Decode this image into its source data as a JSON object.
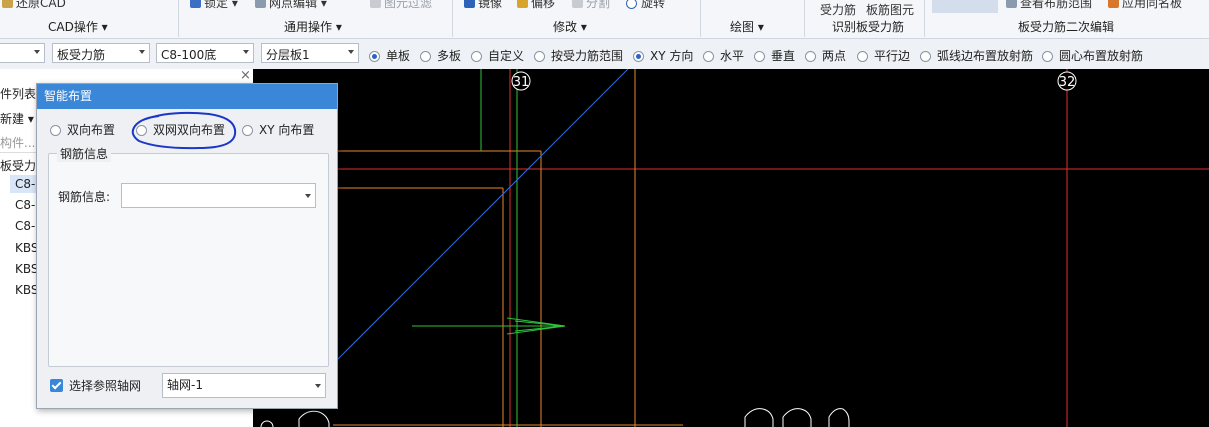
{
  "ribbon": {
    "restore_cad": "还原CAD",
    "cad_ops": "CAD操作",
    "lock": "锁定",
    "axis_edit": "网点编辑",
    "layer_filter": "图元过滤",
    "general_ops": "通用操作",
    "mirror": "镜像",
    "offset": "偏移",
    "split": "分割",
    "rotate": "旋转",
    "modify": "修改",
    "draw": "绘图",
    "rebar_force": "受力筋",
    "slab_rebar_elem": "板筋图元",
    "identify_slab_force": "识别板受力筋",
    "view_layout_range": "查看布筋范围",
    "apply_same_name": "应用同名板",
    "slab_force_second_edit": "板受力筋二次编辑"
  },
  "optionbar": {
    "combo1": "",
    "combo2": "板受力筋",
    "combo3": "C8-100底",
    "combo4": "分层板1",
    "radios": [
      "单板",
      "多板",
      "自定义",
      "按受力筋范围",
      "XY 方向",
      "水平",
      "垂直",
      "两点",
      "平行边",
      "弧线边布置放射筋",
      "圆心布置放射筋"
    ],
    "selected": "XY 方向"
  },
  "leftpanel": {
    "close_glyph": "×",
    "list_label": "件列表",
    "new_label": "新建",
    "search_placeholder": "构件...",
    "tree_root": "板受力筋",
    "items": [
      "C8-",
      "C8-",
      "C8-",
      "KBS",
      "KBS",
      "KBS"
    ]
  },
  "dialog": {
    "title": "智能布置",
    "radio_bidir": "双向布置",
    "radio_double_net": "双网双向布置",
    "radio_xy": "XY 向布置",
    "selected": "双网双向布置",
    "group_title": "钢筋信息",
    "rebar_info_label": "钢筋信息:",
    "rebar_info_value": "",
    "ref_axis_label": "选择参照轴网",
    "ref_axis_checked": true,
    "axis_value": "轴网-1"
  },
  "canvas": {
    "axis_31": "31",
    "axis_32": "32"
  }
}
